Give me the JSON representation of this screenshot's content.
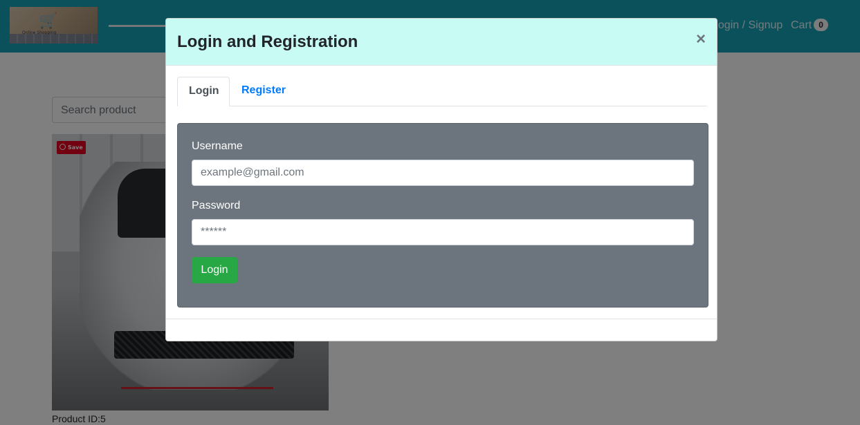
{
  "navbar": {
    "logo_text": "Online Shopping",
    "login_link": "Login / Signup",
    "cart_label": "Cart",
    "cart_count": "0"
  },
  "main": {
    "search_placeholder": "Search product",
    "pin_save_label": "Save",
    "product_id": "Product ID:5"
  },
  "modal": {
    "title": "Login and Registration",
    "close_glyph": "×",
    "tabs": [
      {
        "label": "Login",
        "active": true
      },
      {
        "label": "Register",
        "active": false
      }
    ],
    "form": {
      "username_label": "Username",
      "username_placeholder": "example@gmail.com",
      "password_label": "Password",
      "password_placeholder": "******",
      "submit_label": "Login"
    }
  },
  "colors": {
    "navbar": "#17a2b8",
    "modal_header": "#c8fbf3",
    "form_panel": "#6c757d",
    "login_button": "#28a745",
    "tab_link": "#007bff"
  }
}
